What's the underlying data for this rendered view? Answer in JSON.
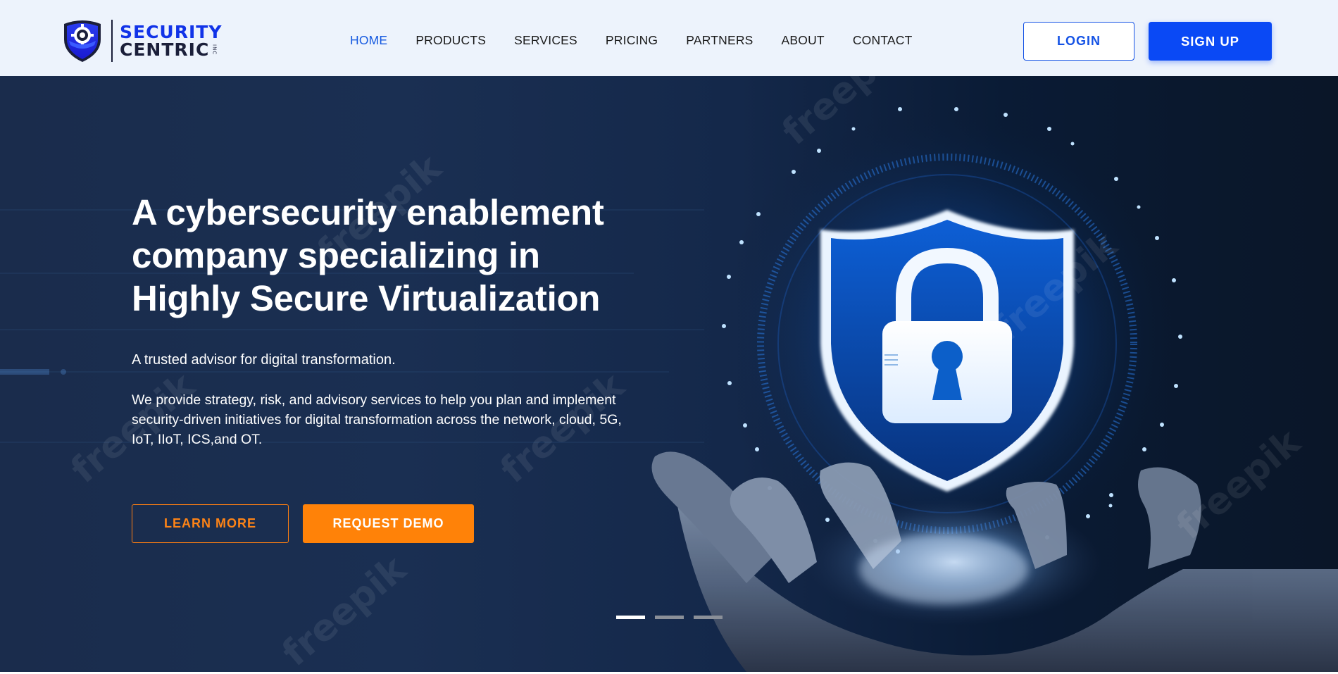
{
  "brand": {
    "line1": "SECURITY",
    "line2": "CENTRIC",
    "suffix": "INC",
    "logo_icon": "shield-gear-logo",
    "primary_color": "#1133e8",
    "accent_color": "#ff8208"
  },
  "nav": {
    "items": [
      {
        "label": "HOME",
        "active": true
      },
      {
        "label": "PRODUCTS",
        "active": false
      },
      {
        "label": "SERVICES",
        "active": false
      },
      {
        "label": "PRICING",
        "active": false
      },
      {
        "label": "PARTNERS",
        "active": false
      },
      {
        "label": "ABOUT",
        "active": false
      },
      {
        "label": "CONTACT",
        "active": false
      }
    ]
  },
  "auth": {
    "login_label": "LOGIN",
    "signup_label": "SIGN UP"
  },
  "hero": {
    "title": "A cybersecurity enablement company specializing in Highly Secure Virtualization",
    "tagline": "A trusted advisor for digital transformation.",
    "description": "We provide strategy, risk, and advisory services to help you plan and implement security-driven initiatives for digital transformation across the network, cloud, 5G, IoT, IIoT, ICS,and OT.",
    "learn_more_label": "LEARN MORE",
    "request_demo_label": "REQUEST DEMO",
    "image_icon": "hand-holding-shield-lock-icon",
    "watermark": "freepik",
    "carousel": {
      "slide_count": 3,
      "active_index": 0
    }
  }
}
